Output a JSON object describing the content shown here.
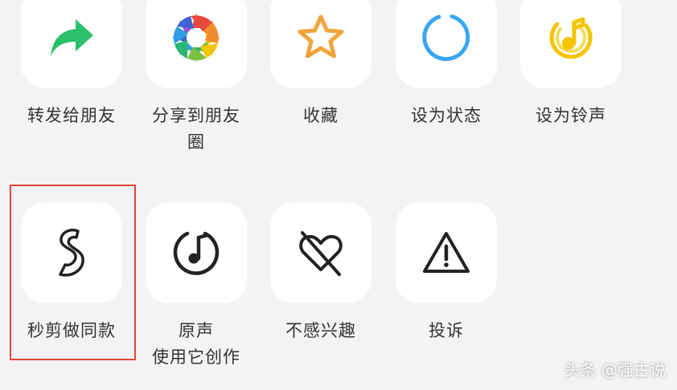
{
  "share_menu": {
    "row1": [
      {
        "label": "转发给朋友",
        "icon": "forward-arrow-icon"
      },
      {
        "label": "分享到朋友\n圈",
        "icon": "moments-aperture-icon"
      },
      {
        "label": "收藏",
        "icon": "star-icon"
      },
      {
        "label": "设为状态",
        "icon": "status-ring-icon"
      },
      {
        "label": "设为铃声",
        "icon": "ringtone-note-icon"
      }
    ],
    "row2": [
      {
        "label": "秒剪做同款",
        "icon": "miaojian-s-icon"
      },
      {
        "label": "原声\n使用它创作",
        "icon": "music-note-circle-icon"
      },
      {
        "label": "不感兴趣",
        "icon": "crossed-heart-icon"
      },
      {
        "label": "投诉",
        "icon": "warning-triangle-icon"
      }
    ]
  },
  "watermark": "头条 @强古说",
  "colors": {
    "forward_green": "#2bc06b",
    "star_orange": "#f2a33a",
    "status_blue": "#3aa6f0",
    "ringtone_yellow": "#f5c400",
    "highlight_red": "#e0453a",
    "icon_dark": "#222222"
  }
}
